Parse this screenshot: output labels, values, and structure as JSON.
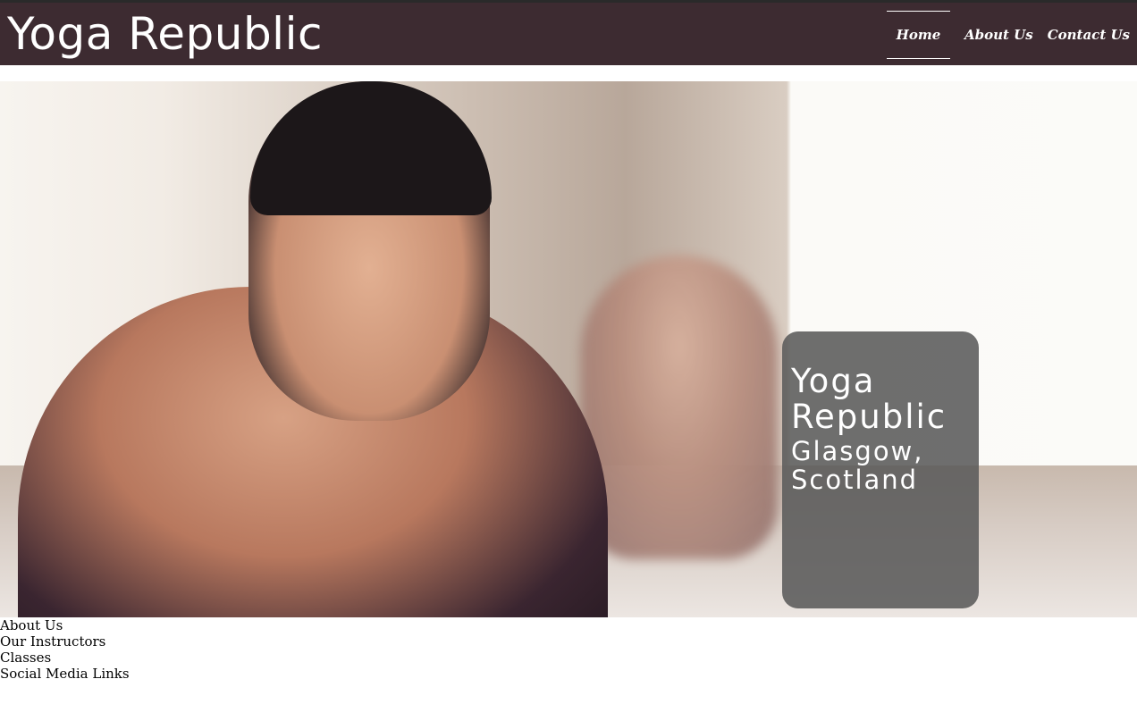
{
  "header": {
    "brand": "Yoga Republic",
    "nav": [
      {
        "label": "Home",
        "active": true
      },
      {
        "label": "About Us",
        "active": false
      },
      {
        "label": "Contact Us",
        "active": false
      }
    ]
  },
  "hero": {
    "image": "woman-doing-yoga-plank-photo",
    "caption_title": "Yoga Republic",
    "caption_subtitle": "Glasgow, Scotland"
  },
  "links": [
    "About Us",
    "Our Instructors",
    "Classes",
    "Social Media Links"
  ],
  "colors": {
    "navbar": "#3d2b31",
    "caption_bg": "#5a5a5a"
  }
}
